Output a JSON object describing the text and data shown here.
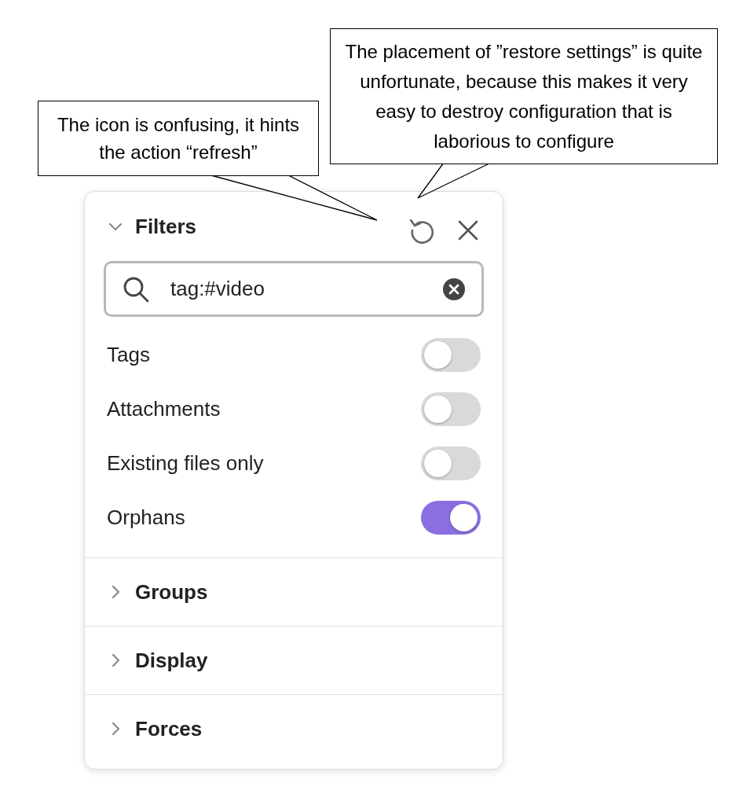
{
  "callouts": [
    {
      "text": "The icon is confusing, it hints the action “refresh”"
    },
    {
      "text": "The placement of ”restore settings” is quite unfortunate, because this makes it very easy to destroy configuration that is laborious to configure"
    }
  ],
  "filters": {
    "title": "Filters",
    "expanded": true,
    "search": {
      "value": "tag:#video"
    },
    "toggles": [
      {
        "label": "Tags",
        "on": false
      },
      {
        "label": "Attachments",
        "on": false
      },
      {
        "label": "Existing files only",
        "on": false
      },
      {
        "label": "Orphans",
        "on": true
      }
    ]
  },
  "sections": [
    {
      "title": "Groups",
      "expanded": false
    },
    {
      "title": "Display",
      "expanded": false
    },
    {
      "title": "Forces",
      "expanded": false
    }
  ]
}
